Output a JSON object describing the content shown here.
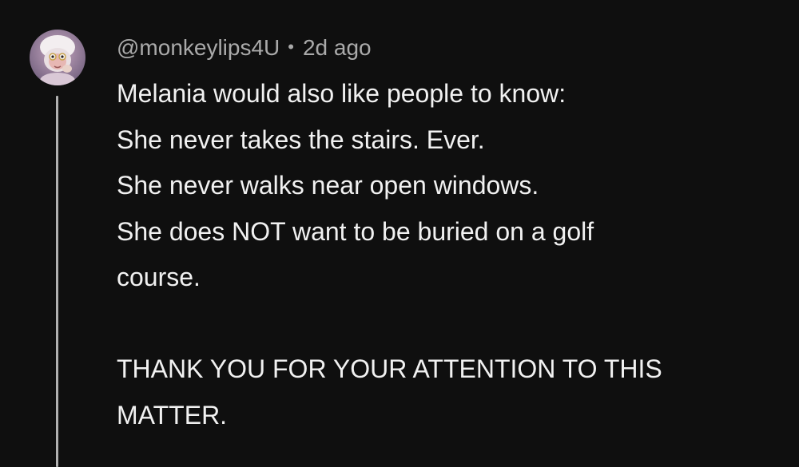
{
  "comment": {
    "author_handle": "@monkeylips4U",
    "separator": "•",
    "timestamp": "2d ago",
    "lines": [
      "Melania would also like people to know:",
      "She never takes the stairs. Ever.",
      "She never walks near open windows.",
      "She does NOT want to be buried on a golf",
      "course.",
      "",
      "THANK YOU FOR YOUR ATTENTION TO THIS",
      "MATTER."
    ]
  },
  "colors": {
    "background": "#0f0f0f",
    "primary_text": "#f1f1f1",
    "secondary_text": "#aaaaaa",
    "thread_line": "#b0b0b0"
  },
  "icons": {
    "avatar": "monkey-avatar-icon"
  }
}
